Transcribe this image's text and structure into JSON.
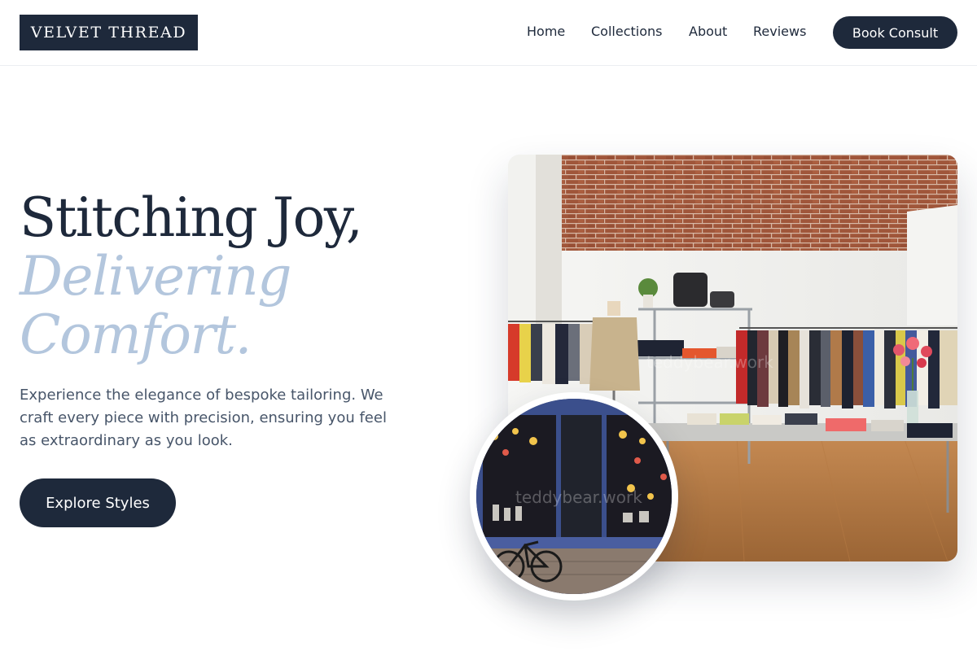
{
  "brand": {
    "logo_text": "VELVET THREAD"
  },
  "nav": {
    "items": [
      {
        "label": "Home"
      },
      {
        "label": "Collections"
      },
      {
        "label": "About"
      },
      {
        "label": "Reviews"
      }
    ],
    "cta_label": "Book Consult"
  },
  "hero": {
    "title_line1": "Stitching Joy,",
    "title_line2": "Delivering",
    "title_line3": "Comfort.",
    "description": "Experience the elegance of bespoke tailoring. We craft every piece with precision, ensuring you feel as extraordinary as you look.",
    "cta_label": "Explore Styles",
    "main_image_watermark": "teddybear.work",
    "circle_image_watermark": "teddybear.work"
  },
  "colors": {
    "primary": "#1e293b",
    "accent": "#b3c6dd",
    "body_text": "#475569",
    "background": "#ffffff"
  }
}
